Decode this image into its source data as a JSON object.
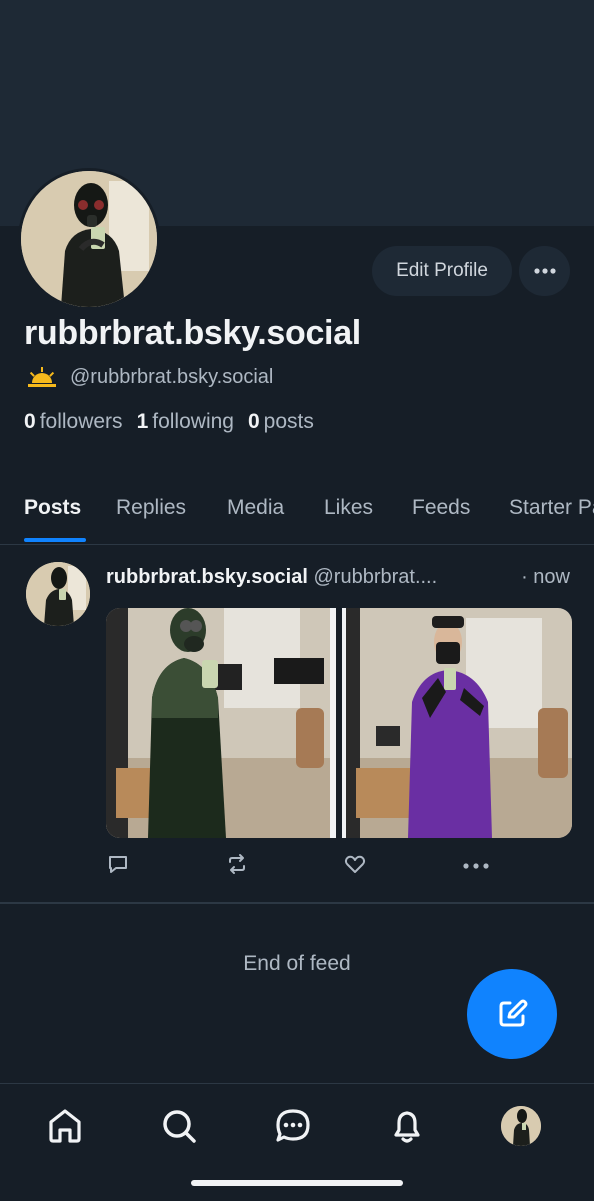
{
  "profile": {
    "display_name": "rubbrbrat.bsky.social",
    "handle": "@rubbrbrat.bsky.social",
    "handle_emoji": "🌅",
    "followers_count": "0",
    "followers_label": "followers",
    "following_count": "1",
    "following_label": "following",
    "posts_count": "0",
    "posts_label": "posts"
  },
  "actions": {
    "edit_profile_label": "Edit Profile",
    "more_icon": "ellipsis-icon"
  },
  "tabs": [
    {
      "label": "Posts",
      "active": true
    },
    {
      "label": "Replies"
    },
    {
      "label": "Media"
    },
    {
      "label": "Likes"
    },
    {
      "label": "Feeds"
    },
    {
      "label": "Starter Packs"
    }
  ],
  "post": {
    "author_name": "rubbrbrat.bsky.social",
    "author_handle": "@rubbrbrat....",
    "time": "· now",
    "images": [
      {
        "description_icon": "photo-green-latex-gasmask"
      },
      {
        "description_icon": "photo-purple-latex-suit"
      }
    ],
    "action_icons": [
      "reply-icon",
      "repost-icon",
      "like-icon",
      "more-icon"
    ]
  },
  "feed": {
    "end_label": "End of feed"
  },
  "nav": {
    "items": [
      "home-icon",
      "search-icon",
      "chat-icon",
      "notifications-icon",
      "profile-avatar"
    ]
  },
  "colors": {
    "background": "#161e27",
    "banner": "#1e2935",
    "accent": "#1083fe",
    "muted_text": "#aeb8c3",
    "primary_text": "#f1f3f5"
  }
}
